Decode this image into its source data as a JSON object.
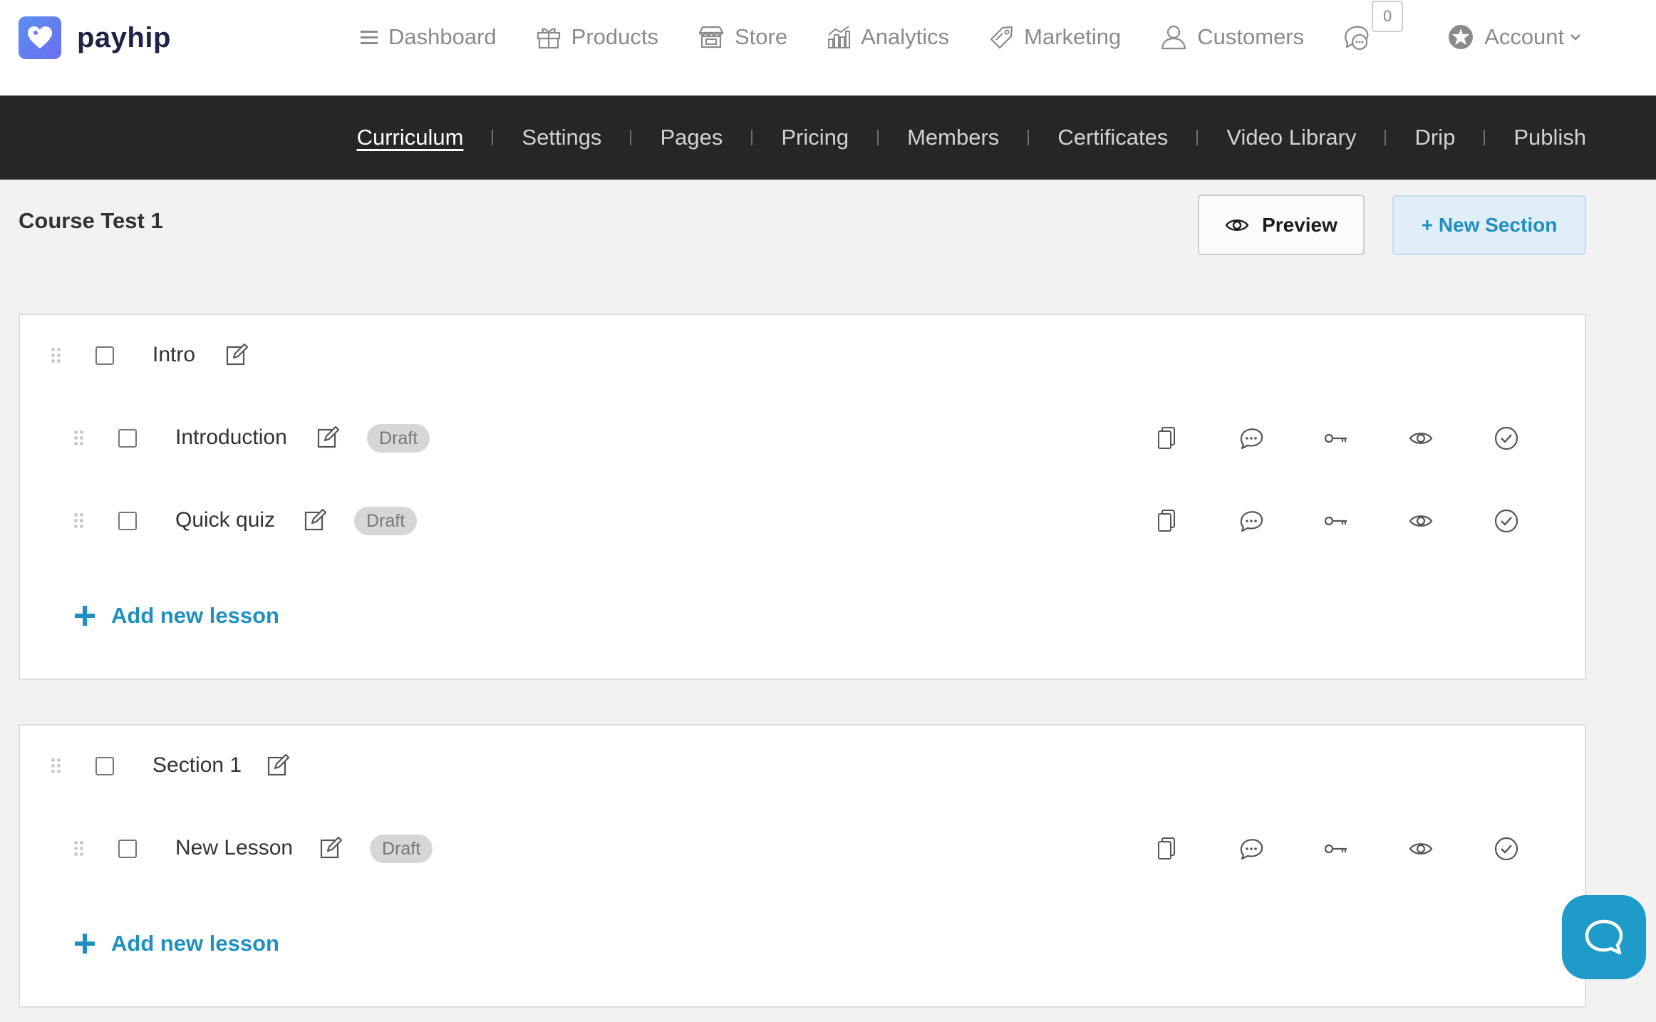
{
  "brand": {
    "name": "payhip",
    "color": "#5b8ff0"
  },
  "nav": {
    "items": [
      {
        "label": "Dashboard",
        "icon": "menu-icon"
      },
      {
        "label": "Products",
        "icon": "gift-icon"
      },
      {
        "label": "Store",
        "icon": "store-icon"
      },
      {
        "label": "Analytics",
        "icon": "analytics-icon"
      },
      {
        "label": "Marketing",
        "icon": "tag-icon"
      },
      {
        "label": "Customers",
        "icon": "user-icon"
      }
    ],
    "messages_count": "0",
    "account_label": "Account"
  },
  "subnav": {
    "items": [
      "Curriculum",
      "Settings",
      "Pages",
      "Pricing",
      "Members",
      "Certificates",
      "Video Library",
      "Drip",
      "Publish"
    ],
    "active": "Curriculum"
  },
  "course": {
    "title": "Course Test 1",
    "preview_label": "Preview",
    "new_section_label": "+ New Section"
  },
  "sections": [
    {
      "title": "Intro",
      "lessons": [
        {
          "title": "Introduction",
          "status": "Draft"
        },
        {
          "title": "Quick quiz",
          "status": "Draft"
        }
      ],
      "add_label": "Add new lesson"
    },
    {
      "title": "Section 1",
      "lessons": [
        {
          "title": "New Lesson",
          "status": "Draft"
        }
      ],
      "add_label": "Add new lesson"
    }
  ],
  "lesson_actions": [
    "copy-icon",
    "comment-icon",
    "key-icon",
    "eye-icon",
    "check-circle-icon"
  ],
  "colors": {
    "accent": "#1f8fc0",
    "subnav_bg": "#262626",
    "chat_bg": "#1e9bc8",
    "badge_bg": "#d6d6d6"
  }
}
